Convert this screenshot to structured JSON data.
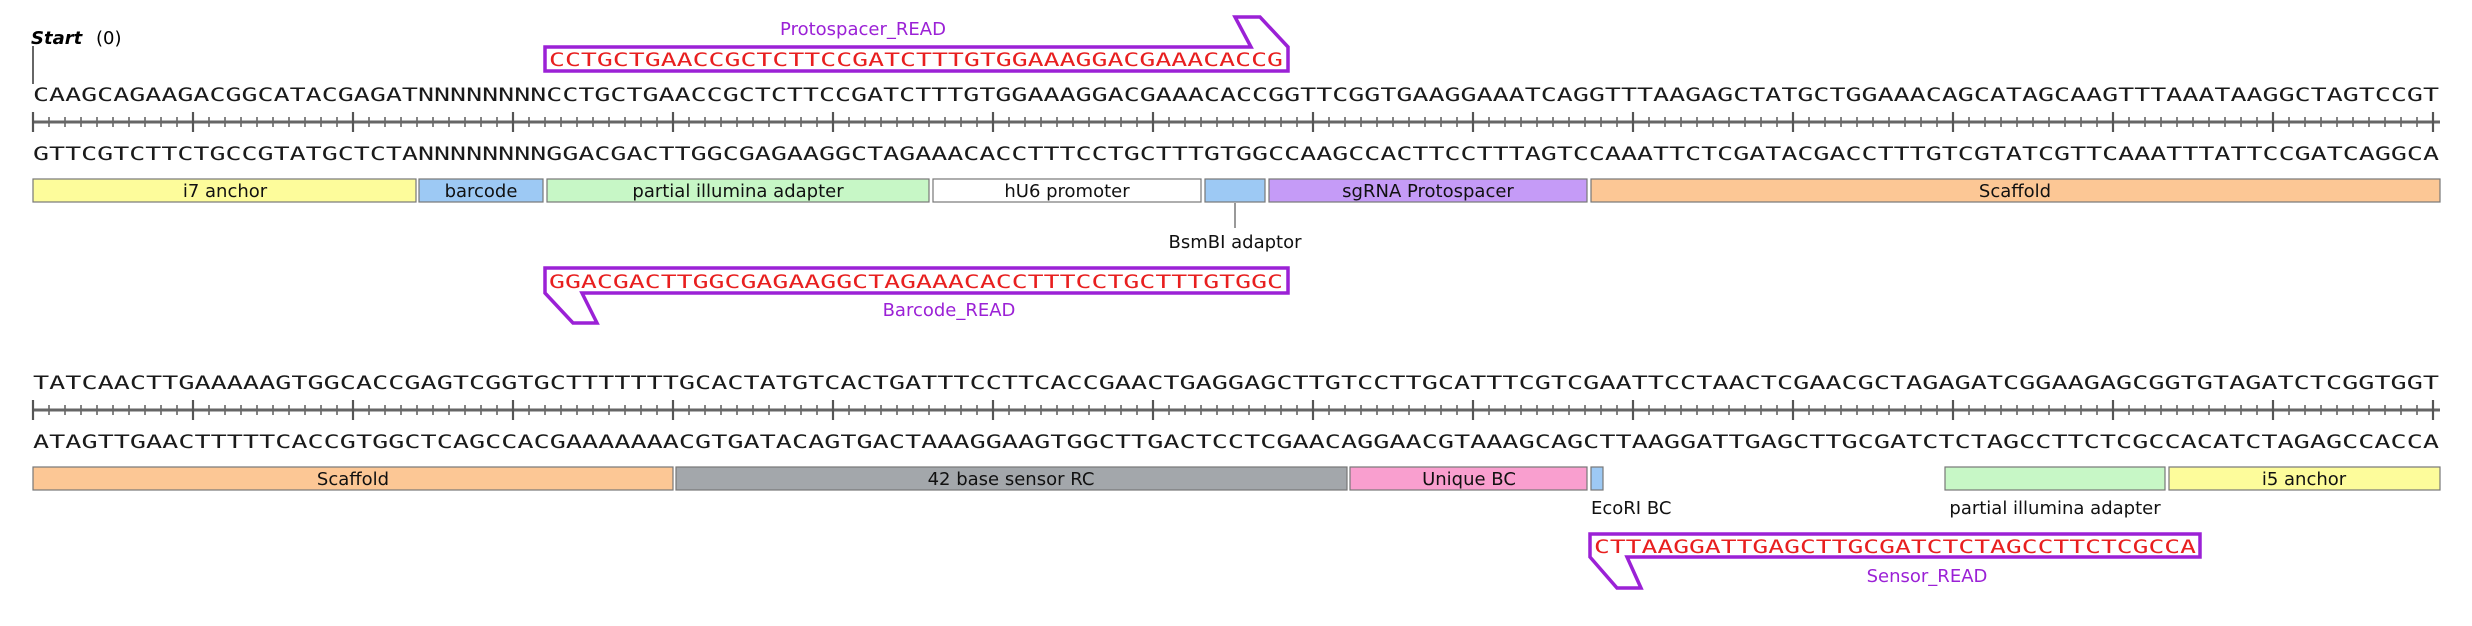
{
  "map": {
    "start_label": "Start",
    "start_position": "(0)",
    "rows": [
      {
        "top_seq": "CAAGCAGAAGACGGCATACGAGATNNNNNNNNCCTGCTGAACCGCTCTTCCGATCTTTGTGGAAAGGACGAAACACCGGTTCGGTGAAGGAAATCAGGTTTAAGAGCTATGCTGGAAACAGCATAGCAAGTTTAAATAAGGCTAGTCCGT",
        "bottom_seq": "GTTCGTCTTCTGCCGTATGCTCTANNNNNNNNGGACGACTTGGCGAGAAGGCTAGAAACACCTTTCCTGCTTTGTGGCCAAGCCACTTCCTTTAGTCCAAATTCTCGATACGACCTTTGTCGTATCGTTCAAATTTATTCCGATCAGGCA",
        "features": [
          {
            "label": "i7 anchor",
            "color": "#fdfc9b"
          },
          {
            "label": "barcode",
            "color": "#9dc9f4"
          },
          {
            "label": "partial illumina adapter",
            "color": "#c7f7c6"
          },
          {
            "label": "hU6 promoter",
            "color": "#ffffff"
          },
          {
            "label": "",
            "color": "#9dc9f4"
          },
          {
            "label": "sgRNA Protospacer",
            "color": "#c59bf7"
          },
          {
            "label": "Scaffold",
            "color": "#fcc795"
          }
        ],
        "callouts": [
          {
            "label": "BsmBI adaptor"
          }
        ],
        "primers": [
          {
            "name": "Protospacer_READ",
            "sequence": "CCTGCTGAACCGCTCTTCCGATCTTTGTGGAAAGGACGAAACACCG",
            "direction": "forward"
          },
          {
            "name": "Barcode_READ",
            "sequence": "GGACGACTTGGCGAGAAGGCTAGAAACACCTTTCCTGCTTTGTGGC",
            "direction": "reverse"
          }
        ]
      },
      {
        "top_seq": "TATCAACTTGAAAAAGTGGCACCGAGTCGGTGCTTTTTTTGCACTATGTCACTGATTTCCTTCACCGAACTGAGGAGCTTGTCCTTGCATTTCGTCGAATTCCTAACTCGAACGCTAGAGATCGGAAGAGCGGTGTAGATCTCGGTGGT",
        "bottom_seq": "ATAGTTGAACTTTTTCACCGTGGCTCAGCCACGAAAAAAACGTGATACAGTGACTAAAGGAAGTGGCTTGACTCCTCGAACAGGAACGTAAAGCAGCTTAAGGATTGAGCTTGCGATCTCTAGCCTTCTCGCCACATCTAGAGCCACCA",
        "features": [
          {
            "label": "Scaffold",
            "color": "#fcc795"
          },
          {
            "label": "42 base sensor RC",
            "color": "#a3a7ab"
          },
          {
            "label": "Unique BC",
            "color": "#f99fcf"
          },
          {
            "label": "",
            "color": "#9dc9f4"
          },
          {
            "label": "partial illumina adapter",
            "color": "#c7f7c6"
          },
          {
            "label": "i5 anchor",
            "color": "#fdfc9b"
          }
        ],
        "callouts": [
          {
            "label": "EcoRI BC"
          }
        ],
        "primers": [
          {
            "name": "Sensor_READ",
            "sequence": "CTTAAGGATTGAGCTTGCGATCTCTAGCCTTCTCGCCA",
            "direction": "reverse"
          }
        ]
      }
    ]
  }
}
